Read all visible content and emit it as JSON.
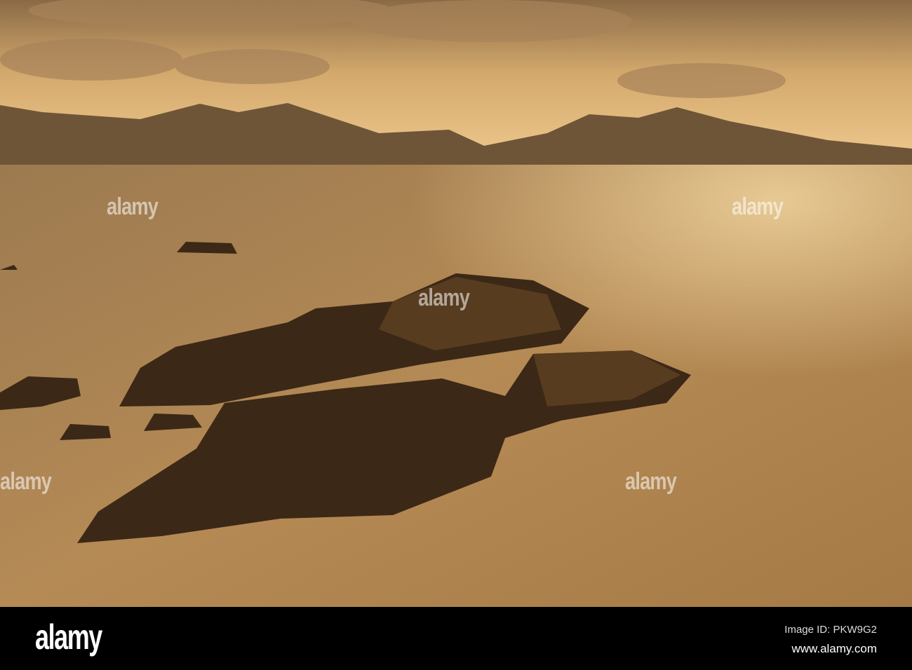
{
  "photo": {
    "watermark": "alamy",
    "colors": {
      "sky": "#d9a766",
      "sea": "#a77f4c",
      "mountain": "#6b5236",
      "rock": "#3a2614"
    }
  },
  "footer": {
    "logo": "alamy",
    "image_id": "Image ID: PKW9G2",
    "site": "www.alamy.com"
  }
}
